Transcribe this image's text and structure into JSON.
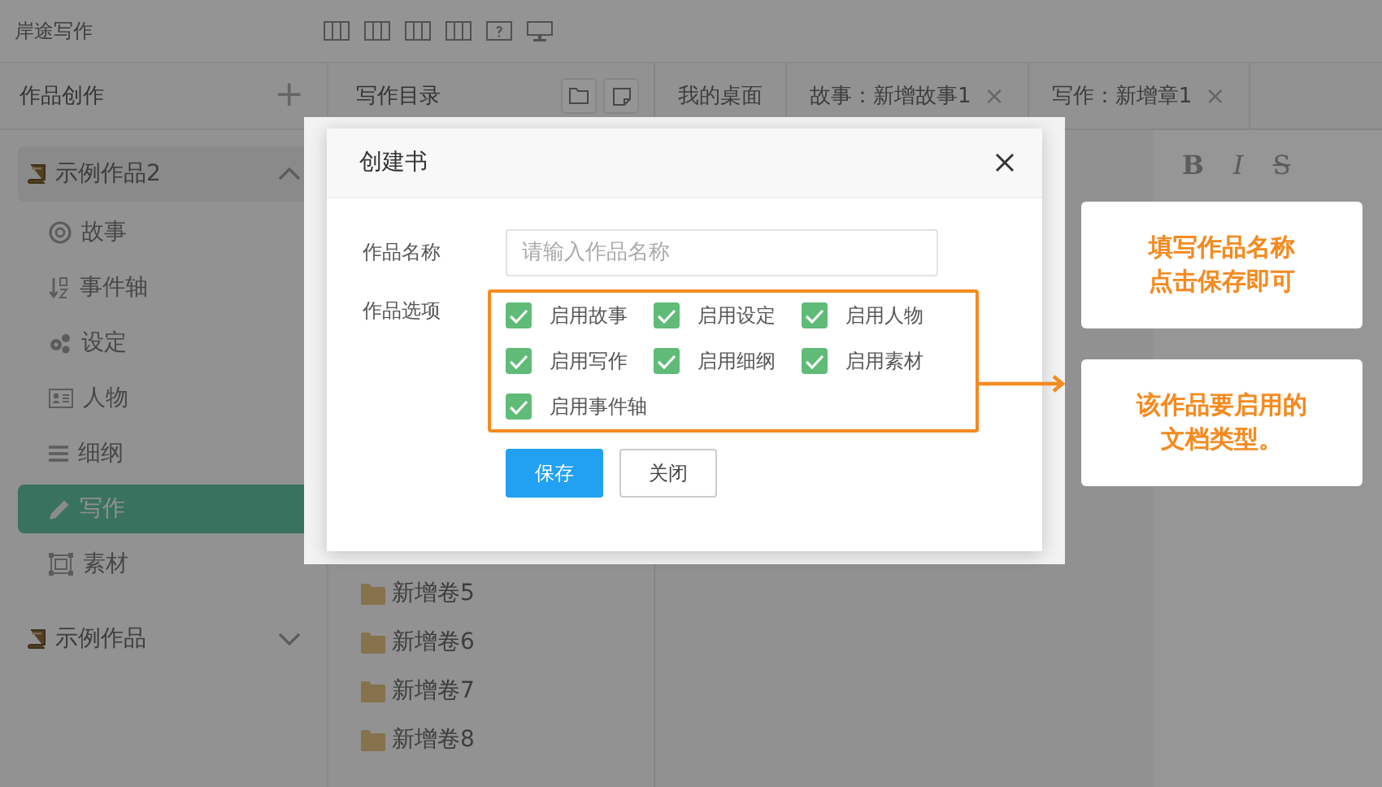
{
  "app": {
    "title": "岸途写作"
  },
  "sidebar": {
    "title": "作品创作",
    "add": "+",
    "projects": [
      {
        "name": "示例作品2",
        "expanded": true,
        "children": [
          {
            "label": "故事",
            "selected": false
          },
          {
            "label": "事件轴",
            "selected": false
          },
          {
            "label": "设定",
            "selected": false
          },
          {
            "label": "人物",
            "selected": false
          },
          {
            "label": "细纲",
            "selected": false
          },
          {
            "label": "写作",
            "selected": true
          },
          {
            "label": "素材",
            "selected": false
          }
        ]
      },
      {
        "name": "示例作品",
        "expanded": false
      }
    ]
  },
  "catalog": {
    "title": "写作目录",
    "folders": [
      "新增卷5",
      "新增卷6",
      "新增卷7",
      "新增卷8"
    ]
  },
  "tabs": [
    {
      "label": "我的桌面",
      "closable": false
    },
    {
      "label": "故事：新增故事1",
      "closable": true
    },
    {
      "label": "写作：新增章1",
      "closable": true
    }
  ],
  "close_glyph": "×",
  "toolbar": [
    "B",
    "I",
    "S"
  ],
  "dialog": {
    "title": "创建书",
    "name_label": "作品名称",
    "name_placeholder": "请输入作品名称",
    "options_label": "作品选项",
    "options": [
      {
        "label": "启用故事",
        "checked": true
      },
      {
        "label": "启用设定",
        "checked": true
      },
      {
        "label": "启用人物",
        "checked": true
      },
      {
        "label": "启用写作",
        "checked": true
      },
      {
        "label": "启用细纲",
        "checked": true
      },
      {
        "label": "启用素材",
        "checked": true
      },
      {
        "label": "启用事件轴",
        "checked": true
      }
    ],
    "buttons": [
      {
        "label": "保存",
        "kind": "primary"
      },
      {
        "label": "关闭",
        "kind": "default"
      }
    ]
  },
  "callouts": [
    "填写作品名称点击保存即可",
    "该作品要启用的文档类型。"
  ]
}
